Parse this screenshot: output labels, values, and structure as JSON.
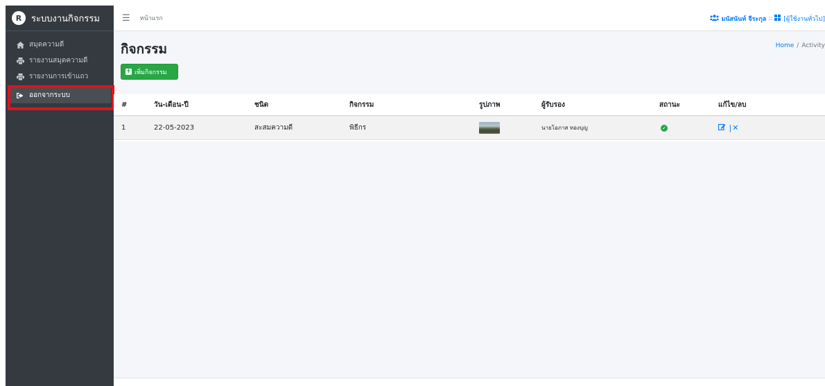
{
  "brand": {
    "logo_letter": "R",
    "title": "ระบบงานกิจกรรม"
  },
  "sidebar": {
    "items": [
      {
        "icon": "home-icon",
        "label": "สมุดความดี"
      },
      {
        "icon": "print-icon",
        "label": "รายงานสมุดความดี"
      },
      {
        "icon": "print-icon",
        "label": "รายงานการเข้าแถว"
      },
      {
        "icon": "sign-out-icon",
        "label": "ออกจากระบบ",
        "active": true
      }
    ]
  },
  "topbar": {
    "home": "หน้าแรก",
    "user_name": "มนัสนันท์ จีระกุล",
    "separator": "::",
    "role": "[ผู้ใช้งานทั่วไป]"
  },
  "page": {
    "title": "กิจกรรม",
    "breadcrumb": {
      "home": "Home",
      "separator": "/",
      "current": "Activity"
    },
    "add_button": "เพิ่มกิจกรรม"
  },
  "table": {
    "headers": [
      "#",
      "วัน-เดือน-ปี",
      "ชนิด",
      "กิจกรรม",
      "รูปภาพ",
      "ผู้รับรอง",
      "สถานะ",
      "แก้ไข/ลบ"
    ],
    "rows": [
      {
        "num": "1",
        "date": "22-05-2023",
        "type": "สะสมความดี",
        "activity": "พิธีกร",
        "certifier": "นายโอภาส ทองบุญ",
        "status": "approved"
      }
    ]
  },
  "colors": {
    "sidebar": "#343a40",
    "primary": "#007bff",
    "success": "#28a745",
    "highlight": "#e5101a"
  }
}
